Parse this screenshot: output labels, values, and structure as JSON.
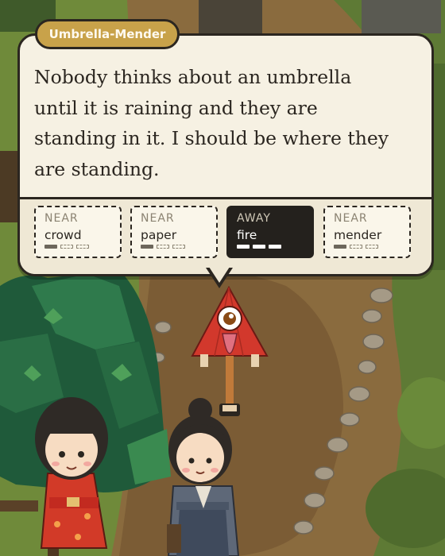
{
  "speaker": "Umbrella-Mender",
  "dialogue": {
    "lines": [
      "Nobody thinks about an umbrella",
      "until it is raining and they are",
      "standing in it. I should be where they",
      "are standing."
    ]
  },
  "cards": [
    {
      "state": "NEAR",
      "word": "crowd",
      "level": 1,
      "max": 3,
      "active": false
    },
    {
      "state": "NEAR",
      "word": "paper",
      "level": 1,
      "max": 3,
      "active": false
    },
    {
      "state": "AWAY",
      "word": "fire",
      "level": 3,
      "max": 3,
      "active": true
    },
    {
      "state": "NEAR",
      "word": "mender",
      "level": 1,
      "max": 3,
      "active": false
    }
  ],
  "colors": {
    "bubble": "#f6f1e3",
    "outline": "#2b2620",
    "name_tag": "#c8a24a",
    "active_card": "#24211d",
    "umbrella_creature": "#d2382c"
  },
  "characters": [
    {
      "name": "umbrella-spirit",
      "icon": "kasa-obake"
    },
    {
      "name": "girl-in-red-kimono",
      "icon": "child-red-kimono"
    },
    {
      "name": "woman-in-grey-kimono",
      "icon": "woman-grey-kimono"
    }
  ]
}
